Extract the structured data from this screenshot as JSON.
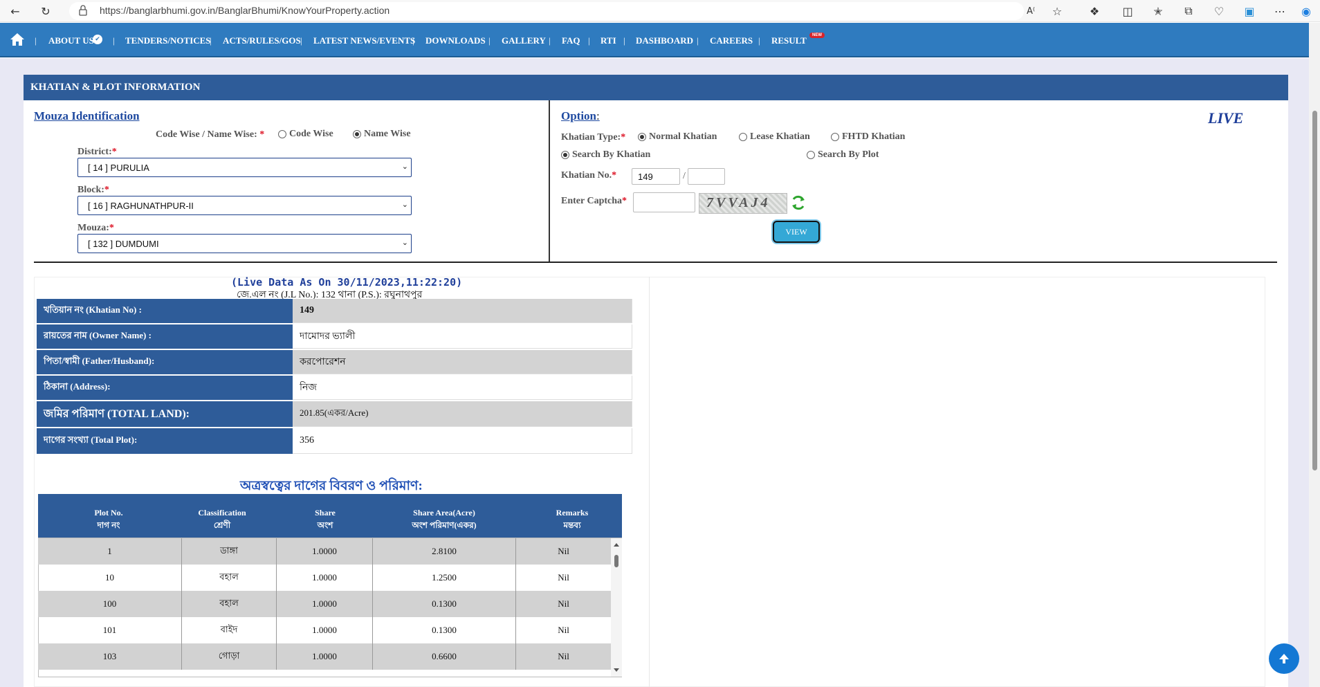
{
  "browser": {
    "url": "https://banglarbhumi.gov.in/BanglarBhumi/KnowYourProperty.action"
  },
  "nav": {
    "items": [
      "ABOUT US",
      "TENDERS/NOTICES",
      "ACTS/RULES/GOS",
      "LATEST NEWS/EVENTS",
      "DOWNLOADS",
      "GALLERY",
      "FAQ",
      "RTI",
      "DASHBOARD",
      "CAREERS",
      "RESULT"
    ],
    "new_badge": "NEW"
  },
  "panel": {
    "title": "KHATIAN & PLOT INFORMATION"
  },
  "mouza": {
    "title": "Mouza Identification",
    "mode_label": "Code Wise / Name Wise:",
    "req": "*",
    "opt_code": "Code Wise",
    "opt_name": "Name Wise",
    "district_label": "District:",
    "district_value": "[ 14 ] PURULIA",
    "block_label": "Block:",
    "block_value": "[ 16 ] RAGHUNATHPUR-II",
    "mouza_label": "Mouza:",
    "mouza_value": "[ 132 ] DUMDUMI"
  },
  "option": {
    "title": "Option",
    "colon": ":",
    "live": "LIVE",
    "khatian_type_label": "Khatian Type:",
    "opt_normal": "Normal Khatian",
    "opt_lease": "Lease Khatian",
    "opt_fhtd": "FHTD Khatian",
    "opt_search_khatian": "Search By Khatian",
    "opt_search_plot": "Search By Plot",
    "khatian_no_label": "Khatian No.",
    "khatian_no_value": "149",
    "slash": "/",
    "captcha_label": "Enter Captcha",
    "captcha_text": "7VVAJ4",
    "view_label": "VIEW"
  },
  "result": {
    "live_data": "(Live Data As On 30/11/2023,11:22:20)",
    "jl_line": "জে.এল নং (J.L No.): 132  থানা (P.S.): রঘুনাথপুর",
    "rows": [
      {
        "key": "খতিয়ান নং  (Khatian No) :",
        "value": "149"
      },
      {
        "key": "রায়তের নাম  (Owner Name) :",
        "value": "দামোদর ভ্যালী"
      },
      {
        "key": "পিতা/স্বামী  (Father/Husband):",
        "value": "করপোরেশন"
      },
      {
        "key": "ঠিকানা        (Address):",
        "value": "নিজ"
      },
      {
        "key": "জমির পরিমাণ (TOTAL LAND):",
        "value": "201.85(একর/Acre)"
      },
      {
        "key": "দাগের সংখ্যা (Total Plot):",
        "value": "356"
      }
    ],
    "plot_title": "অত্রস্বত্বের দাগের বিবরণ ও পরিমাণ:",
    "headers": [
      {
        "en": "Plot No.",
        "bn": "দাগ নং"
      },
      {
        "en": "Classification",
        "bn": "শ্রেণী"
      },
      {
        "en": "Share",
        "bn": "অংশ"
      },
      {
        "en": "Share Area(Acre)",
        "bn": "অংশ পরিমাণ(একর)"
      },
      {
        "en": "Remarks",
        "bn": "মন্তব্য"
      }
    ],
    "plots": [
      {
        "plot": "1",
        "class": "ডাঙ্গা",
        "share": "1.0000",
        "area": "2.8100",
        "remarks": "Nil"
      },
      {
        "plot": "10",
        "class": "বহাল",
        "share": "1.0000",
        "area": "1.2500",
        "remarks": "Nil"
      },
      {
        "plot": "100",
        "class": "বহাল",
        "share": "1.0000",
        "area": "0.1300",
        "remarks": "Nil"
      },
      {
        "plot": "101",
        "class": "বাইদ",
        "share": "1.0000",
        "area": "0.1300",
        "remarks": "Nil"
      },
      {
        "plot": "103",
        "class": "গোড়া",
        "share": "1.0000",
        "area": "0.6600",
        "remarks": "Nil"
      }
    ]
  }
}
